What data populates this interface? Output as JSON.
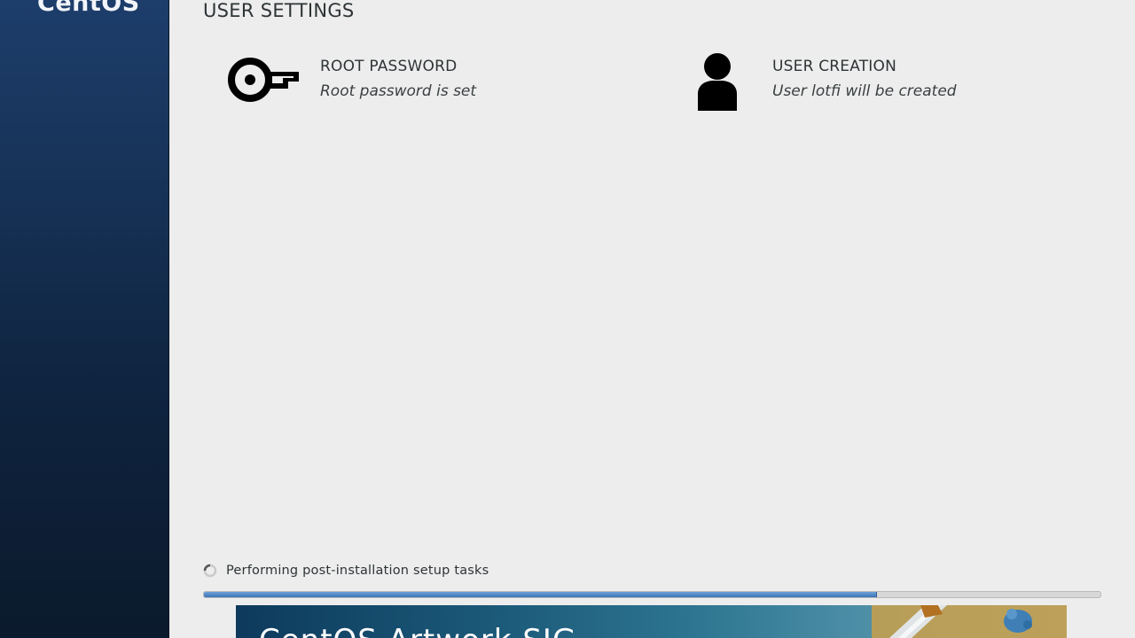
{
  "brand": {
    "logo_text": "CentOS"
  },
  "header": {
    "section_title": "USER SETTINGS"
  },
  "spokes": [
    {
      "title": "ROOT PASSWORD",
      "status": "Root password is set",
      "icon": "key-icon"
    },
    {
      "title": "USER CREATION",
      "status": "User lotfi will be created",
      "icon": "user-icon"
    }
  ],
  "progress": {
    "status_text": "Performing post-installation setup tasks",
    "fraction": 0.75,
    "icon": "spinner-icon"
  },
  "banner": {
    "title": "CentOS Artwork SIG"
  },
  "colors": {
    "sidebar": "#163256",
    "background": "#ededed",
    "progress_fill": "#3d73b8"
  }
}
